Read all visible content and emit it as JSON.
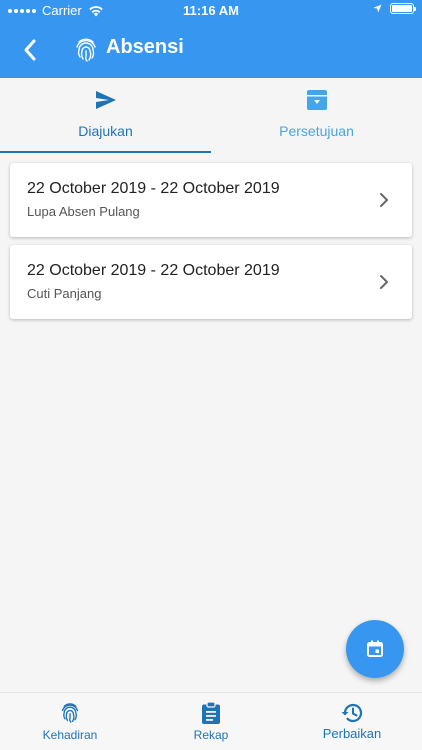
{
  "status_bar": {
    "carrier": "Carrier",
    "time": "11:16 AM"
  },
  "app_bar": {
    "title": "Absensi",
    "back_icon": "chevron-left-icon",
    "app_icon": "fingerprint-icon"
  },
  "tabs": [
    {
      "label": "Diajukan",
      "icon": "send-icon",
      "active": true
    },
    {
      "label": "Persetujuan",
      "icon": "archive-icon",
      "active": false
    }
  ],
  "requests": [
    {
      "date_range": "22 October 2019 - 22 October 2019",
      "type": "Lupa Absen Pulang"
    },
    {
      "date_range": "22 October 2019 - 22 October 2019",
      "type": "Cuti Panjang"
    }
  ],
  "fab": {
    "icon": "calendar-icon"
  },
  "bottom_nav": [
    {
      "label": "Kehadiran",
      "icon": "fingerprint-icon"
    },
    {
      "label": "Rekap",
      "icon": "clipboard-icon"
    },
    {
      "label": "Perbaikan",
      "icon": "history-icon"
    }
  ],
  "colors": {
    "primary": "#3797f0",
    "accent": "#1f73b7",
    "background": "#f5f5f5"
  }
}
